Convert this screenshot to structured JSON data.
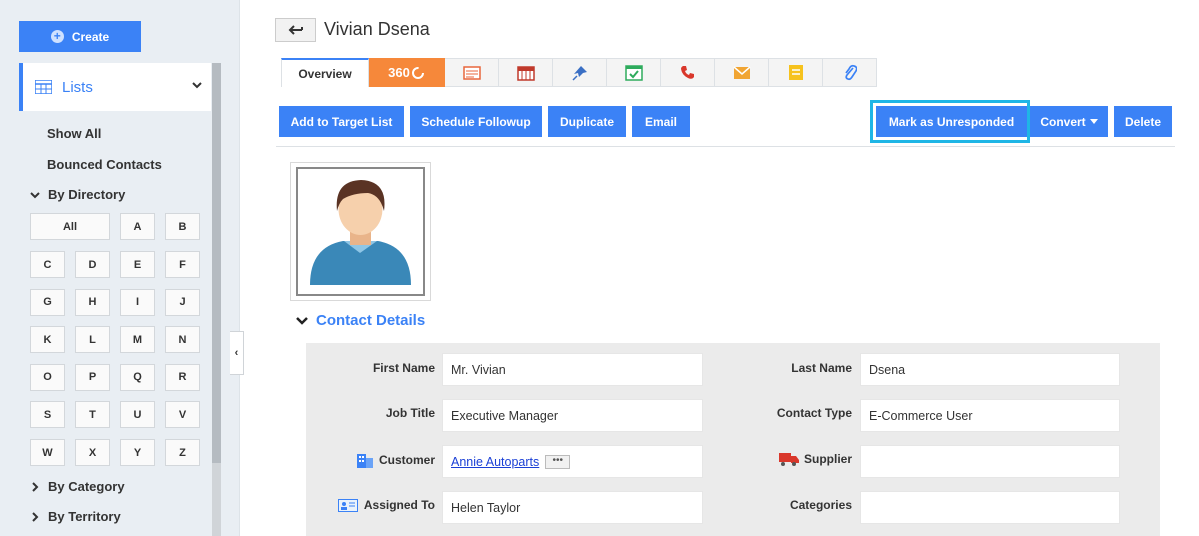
{
  "sidebar": {
    "create_label": "Create",
    "lists_label": "Lists",
    "show_all": "Show All",
    "bounced": "Bounced Contacts",
    "by_directory": "By Directory",
    "by_category": "By Category",
    "by_territory": "By Territory",
    "keys": [
      "All",
      "A",
      "B",
      "C",
      "D",
      "E",
      "F",
      "G",
      "H",
      "I",
      "J",
      "K",
      "L",
      "M",
      "N",
      "O",
      "P",
      "Q",
      "R",
      "S",
      "T",
      "U",
      "V",
      "W",
      "X",
      "Y",
      "Z"
    ]
  },
  "header": {
    "title": "Vivian Dsena"
  },
  "tabs": {
    "overview": "Overview",
    "t360": "360"
  },
  "actions": {
    "add_target": "Add to Target List",
    "schedule": "Schedule Followup",
    "duplicate": "Duplicate",
    "email": "Email",
    "mark_unresponded": "Mark as Unresponded",
    "convert": "Convert",
    "delete": "Delete"
  },
  "section": {
    "title": "Contact Details"
  },
  "fields": {
    "first_name_label": "First Name",
    "first_name": "Mr. Vivian",
    "last_name_label": "Last Name",
    "last_name": "Dsena",
    "job_title_label": "Job Title",
    "job_title": "Executive Manager",
    "contact_type_label": "Contact Type",
    "contact_type": "E-Commerce User",
    "customer_label": "Customer",
    "customer": "Annie Autoparts",
    "customer_more": "•••",
    "supplier_label": "Supplier",
    "supplier": "",
    "assigned_label": "Assigned To",
    "assigned": "Helen Taylor",
    "categories_label": "Categories",
    "categories": ""
  }
}
